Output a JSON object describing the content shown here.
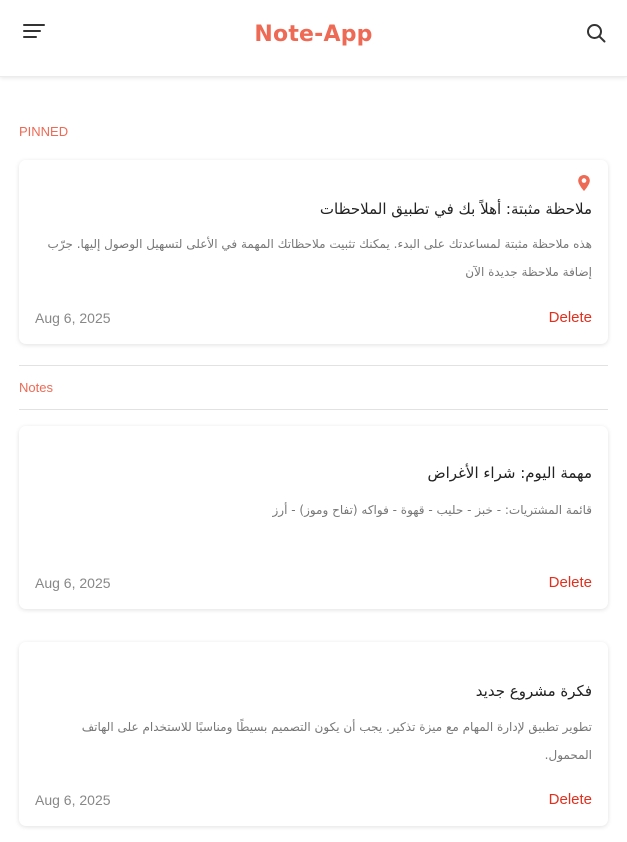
{
  "header": {
    "title": "Note-App",
    "menu_icon": "hamburger-menu-icon",
    "search_icon": "search-icon",
    "accent_color": "#ee6a55"
  },
  "pinned_section": {
    "label": "PINNED",
    "notes": [
      {
        "pinned": true,
        "title": "ملاحظة مثبتة: أهلاً بك في تطبيق الملاحظات",
        "body": "هذه ملاحظة مثبتة لمساعدتك على البدء. يمكنك تثبيت ملاحظاتك المهمة في الأعلى لتسهيل الوصول إليها. جرّب إضافة ملاحظة جديدة الآن",
        "date": "Aug 6, 2025",
        "delete_label": "Delete"
      }
    ]
  },
  "notes_section": {
    "label": "Notes",
    "notes": [
      {
        "title": "مهمة اليوم: شراء الأغراض",
        "body": "قائمة المشتريات: - خبز - حليب - قهوة - فواكه (تفاح وموز) - أرز",
        "date": "Aug 6, 2025",
        "delete_label": "Delete"
      },
      {
        "title": "فكرة مشروع جديد",
        "body": "تطوير تطبيق لإدارة المهام مع ميزة تذكير. يجب أن يكون التصميم بسيطًا ومناسبًا للاستخدام على الهاتف المحمول.",
        "date": "Aug 6, 2025",
        "delete_label": "Delete"
      }
    ]
  },
  "colors": {
    "accent": "#ee6a55",
    "delete": "#e0301e"
  }
}
